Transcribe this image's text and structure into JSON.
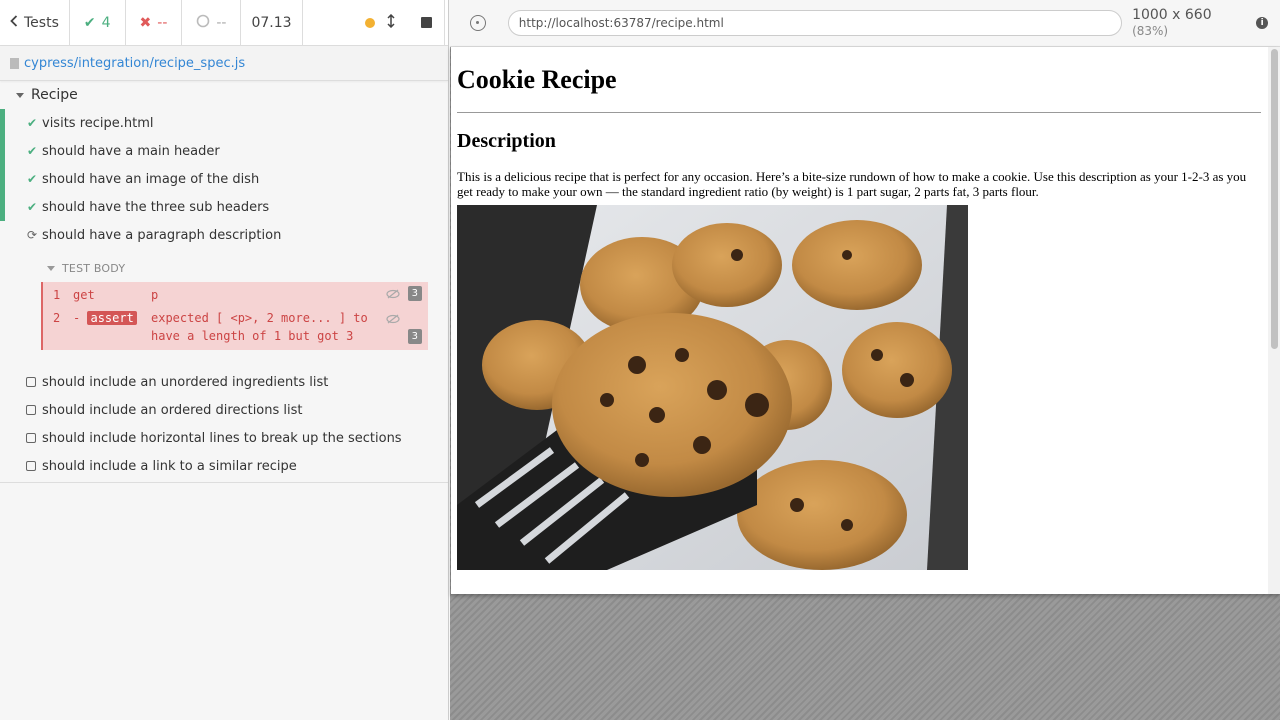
{
  "reporter": {
    "back_label": "Tests",
    "passed": "4",
    "failed": "--",
    "pending": "--",
    "duration": "07.13",
    "spec_path": "cypress/integration/recipe_spec.js",
    "suite_title": "Recipe",
    "tests": [
      {
        "title": "visits recipe.html",
        "state": "passed"
      },
      {
        "title": "should have a main header",
        "state": "passed"
      },
      {
        "title": "should have an image of the dish",
        "state": "passed"
      },
      {
        "title": "should have the three sub headers",
        "state": "passed"
      },
      {
        "title": "should have a paragraph description",
        "state": "running"
      },
      {
        "title": "should include an unordered ingredients list",
        "state": "pending"
      },
      {
        "title": "should include an ordered directions list",
        "state": "pending"
      },
      {
        "title": "should include horizontal lines to break up the sections",
        "state": "pending"
      },
      {
        "title": "should include a link to a similar recipe",
        "state": "pending"
      }
    ],
    "test_body_label": "TEST BODY",
    "commands": [
      {
        "num": "1",
        "name": "get",
        "message": "p",
        "count": "3"
      },
      {
        "num": "2",
        "name": "assert",
        "prefix": "-",
        "message": "expected [ <p>, 2 more... ] to have a length of 1 but got 3",
        "count": "3"
      }
    ]
  },
  "aut": {
    "url": "http://localhost:63787/recipe.html",
    "viewport": "1000 x 660",
    "scale": "(83%)",
    "page": {
      "h1": "Cookie Recipe",
      "h2": "Description",
      "paragraph": "This is a delicious recipe that is perfect for any occasion. Here’s a bite-size rundown of how to make a cookie. Use this description as your 1-2-3 as you get ready to make your own — the standard ingredient ratio (by weight) is 1 part sugar, 2 parts fat, 3 parts flour."
    }
  },
  "colors": {
    "passed": "#4caf80",
    "failed": "#e05a5a",
    "running_dot": "#f3b132",
    "link": "#3386d4",
    "error_bg": "#f5d3d3"
  }
}
